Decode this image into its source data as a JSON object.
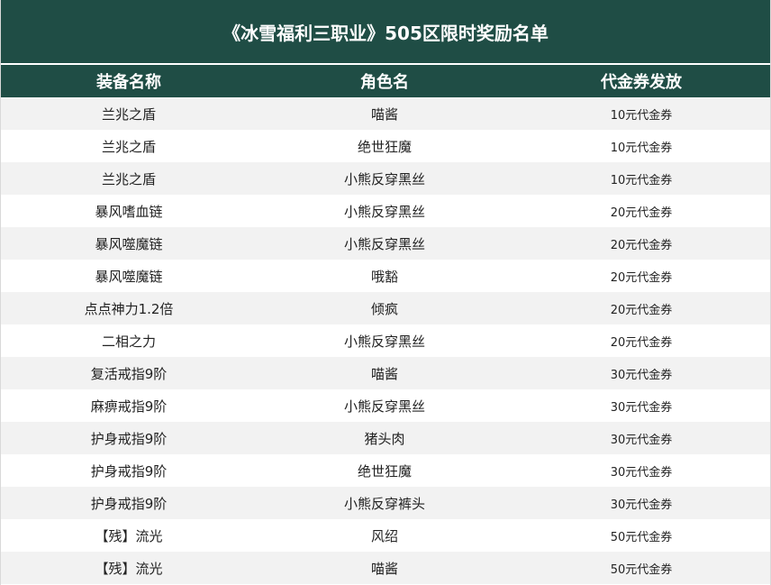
{
  "title": "《冰雪福利三职业》505区限时奖励名单",
  "columns": [
    "装备名称",
    "角色名",
    "代金券发放"
  ],
  "rows": [
    {
      "equipment": "兰兆之盾",
      "role": "喵酱",
      "reward": "10元代金券"
    },
    {
      "equipment": "兰兆之盾",
      "role": "绝世狂魔",
      "reward": "10元代金券"
    },
    {
      "equipment": "兰兆之盾",
      "role": "小熊反穿黑丝",
      "reward": "10元代金券"
    },
    {
      "equipment": "暴风嗜血链",
      "role": "小熊反穿黑丝",
      "reward": "20元代金券"
    },
    {
      "equipment": "暴风噬魔链",
      "role": "小熊反穿黑丝",
      "reward": "20元代金券"
    },
    {
      "equipment": "暴风噬魔链",
      "role": "哦豁",
      "reward": "20元代金券"
    },
    {
      "equipment": "点点神力1.2倍",
      "role": "倾疯",
      "reward": "20元代金券"
    },
    {
      "equipment": "二相之力",
      "role": "小熊反穿黑丝",
      "reward": "20元代金券"
    },
    {
      "equipment": "复活戒指9阶",
      "role": "喵酱",
      "reward": "30元代金券"
    },
    {
      "equipment": "麻痹戒指9阶",
      "role": "小熊反穿黑丝",
      "reward": "30元代金券"
    },
    {
      "equipment": "护身戒指9阶",
      "role": "猪头肉",
      "reward": "30元代金券"
    },
    {
      "equipment": "护身戒指9阶",
      "role": "绝世狂魔",
      "reward": "30元代金券"
    },
    {
      "equipment": "护身戒指9阶",
      "role": "小熊反穿裤头",
      "reward": "30元代金券"
    },
    {
      "equipment": "【残】流光",
      "role": "风绍",
      "reward": "50元代金券"
    },
    {
      "equipment": "【残】流光",
      "role": "喵酱",
      "reward": "50元代金券"
    }
  ],
  "colors": {
    "header_bg": "#1f4d45",
    "header_text": "#ffffff",
    "row_alt_bg": "#f2f2f2",
    "row_bg": "#ffffff",
    "cell_text": "#222222"
  }
}
